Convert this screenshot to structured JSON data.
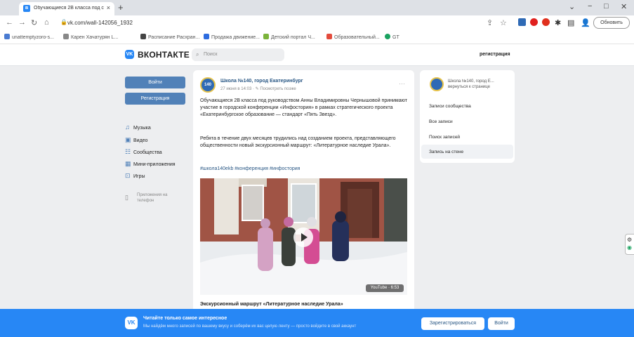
{
  "browser": {
    "tab_title": "Обучающиеся 2В класса под с...",
    "tab_close": "×",
    "new_tab": "+",
    "window_controls": [
      "⌄",
      "−",
      "□",
      "✕"
    ],
    "url": "vk.com/wall-142056_1932",
    "update_button": "Обновить",
    "bookmarks": [
      {
        "label": "unattemptyzoro-s...",
        "color": "#4a7bd1"
      },
      {
        "label": "Карен Хачатурян L...",
        "color": "#888888"
      },
      {
        "label": "Расписание Расхран...",
        "color": "#444444"
      },
      {
        "label": "Продажа движение...",
        "color": "#2d6cdf"
      },
      {
        "label": "Детский портал Ч...",
        "color": "#7bb33a"
      },
      {
        "label": "Образовательный...",
        "color": "#e34b3c"
      },
      {
        "label": "GT",
        "color": "#1aa260"
      }
    ]
  },
  "vk": {
    "brand_mark": "VK",
    "brand": "ВКОНТАКТЕ",
    "search_placeholder": "Поиск",
    "register_link": "регистрация",
    "login_button": "Войти",
    "register_button": "Регистрация",
    "nav": [
      {
        "icon": "music-icon",
        "glyph": "♫",
        "label": "Музыка"
      },
      {
        "icon": "video-icon",
        "glyph": "▣",
        "label": "Видео"
      },
      {
        "icon": "communities-icon",
        "glyph": "☷",
        "label": "Сообщества"
      },
      {
        "icon": "mini-apps-icon",
        "glyph": "▦",
        "label": "Мини-приложения"
      },
      {
        "icon": "games-icon",
        "glyph": "⊡",
        "label": "Игры"
      }
    ],
    "phone_apps": "Приложения на телефон",
    "post": {
      "avatar_text": "140",
      "group": "Школа №140, город Екатеринбург",
      "date": "27 июня в 14:03 · ✎ Посмотреть позже",
      "menu": "···",
      "text1": "Обучающиеся 2В класса под руководством Анны Владимировны Чернышовой принимают участие в городской конференции «Инфостория» в рамках стратегического проекта «Екатеринбургское образование — стандарт «Пять Звезд».",
      "text2": "Ребята в течение двух месяцев трудились над созданием проекта, представляющего общественности новый экскурсионный маршрут: «Литературное наследие Урала».",
      "hashtags": "#школа140ekb #конференция #инфостория",
      "video_label": "YouTube · 6:53",
      "caption": "Экскурсионный маршрут «Литературное наследие Урала»"
    },
    "right_panel": {
      "group": "Школа №140, город Е... вернуться к странице",
      "items": [
        "Записи сообщества",
        "Все записи",
        "Поиск записей",
        "Запись на стене"
      ]
    },
    "banner": {
      "logo": "VK",
      "title": "Читайте только самое интересное",
      "subtitle": "Мы найдём много записей по вашему вкусу и соберём их вас целую ленту — просто войдите в свой аккаунт",
      "register": "Зарегистрироваться",
      "login": "Войти"
    }
  }
}
